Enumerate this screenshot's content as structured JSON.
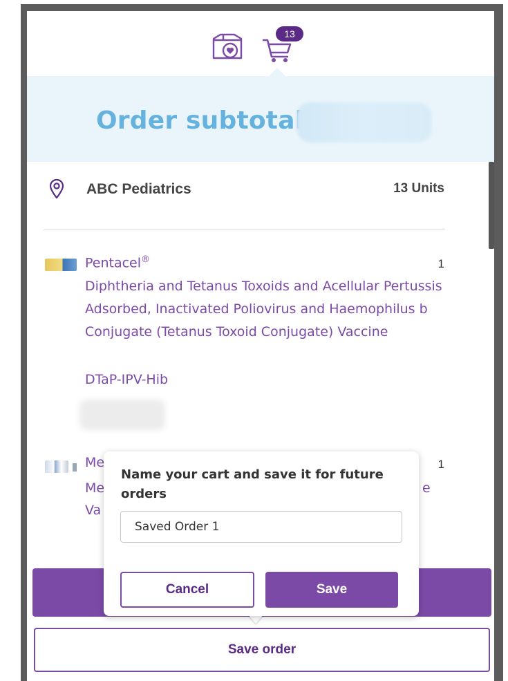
{
  "header": {
    "cart_badge_count": "13",
    "icons": [
      "box-heart-icon",
      "cart-icon"
    ]
  },
  "subtotal": {
    "label": "Order subtotal"
  },
  "location": {
    "icon": "location-pin-icon",
    "name": "ABC Pediatrics",
    "units": "13 Units"
  },
  "products": [
    {
      "name": "Pentacel",
      "trademark": "®",
      "description": "Diphtheria and Tetanus Toxoids and Acellular Pertussis Adsorbed, Inactivated Poliovirus and Haemophilus b Conjugate (Tetanus Toxoid Conjugate) Vaccine",
      "abbreviation": "DTaP-IPV-Hib",
      "quantity": "1"
    },
    {
      "name_partial": "Me",
      "line2_partial": "Me",
      "line3_partial": "Va",
      "line2_tail": "e",
      "quantity": "1"
    }
  ],
  "save_popover": {
    "title": "Name your cart and save it for future orders",
    "input_value": "Saved Order 1",
    "cancel_label": "Cancel",
    "save_label": "Save"
  },
  "save_order_label": "Save order",
  "colors": {
    "brand_purple": "#7b4aa6",
    "dark_purple": "#5a2a86",
    "subtotal_bg": "#eaf5fb",
    "subtotal_text": "#66b2de"
  }
}
